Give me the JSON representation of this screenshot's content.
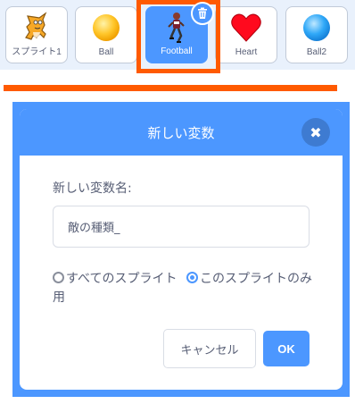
{
  "sprites": [
    {
      "label": "スプライト1",
      "icon": "cat-sprite-icon",
      "selected": false
    },
    {
      "label": "Ball",
      "icon": "ball-sprite-icon",
      "selected": false
    },
    {
      "label": "Football",
      "icon": "football-player-sprite-icon",
      "selected": true
    },
    {
      "label": "Heart",
      "icon": "heart-sprite-icon",
      "selected": false
    },
    {
      "label": "Ball2",
      "icon": "ball2-sprite-icon",
      "selected": false
    }
  ],
  "dialog": {
    "title": "新しい変数",
    "field_label": "新しい変数名:",
    "name_value": "敵の種類_",
    "radio_all_sprites": "すべてのスプライト用",
    "radio_this_sprite": "このスプライトのみ",
    "selected_option": "this_sprite",
    "cancel_label": "キャンセル",
    "ok_label": "OK",
    "close_glyph": "✖"
  },
  "colors": {
    "accent": "#4c97ff",
    "highlight": "#ff5a00",
    "text": "#575e75"
  }
}
